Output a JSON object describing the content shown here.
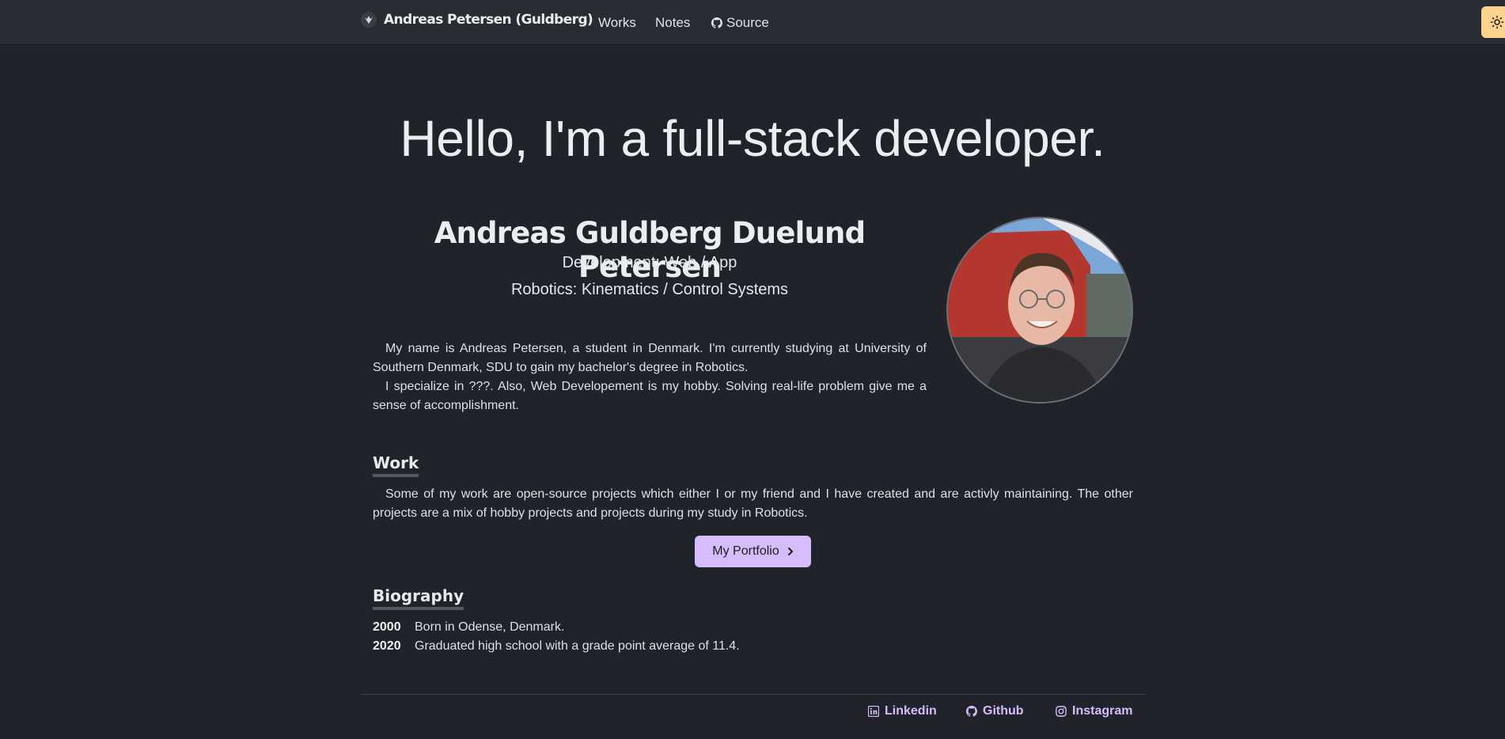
{
  "nav": {
    "brand": "Andreas Petersen (Guldberg)",
    "links": [
      {
        "label": "Works"
      },
      {
        "label": "Notes"
      },
      {
        "label": "Source",
        "icon": "github-icon"
      }
    ],
    "theme_toggle_icon": "sun-icon"
  },
  "hero": {
    "title": "Hello, I'm a full-stack developer."
  },
  "profile": {
    "name": "Andreas Guldberg Duelund Petersen",
    "subtitles": [
      "Development: Web / App",
      "Robotics: Kinematics / Control Systems"
    ]
  },
  "intro": {
    "paragraphs": [
      "My name is Andreas Petersen, a student in Denmark. I'm currently studying at University of Southern Denmark, SDU to gain my bachelor's degree in Robotics.",
      "I specialize in ???. Also, Web Developement is my hobby. Solving real-life problem give me a sense of accomplishment."
    ]
  },
  "work": {
    "heading": "Work",
    "text": "Some of my work are open-source projects which either I or my friend and I have created and are activly maintaining. The other projects are a mix of hobby projects and projects during my study in Robotics.",
    "button_label": "My Portfolio"
  },
  "biography": {
    "heading": "Biography",
    "entries": [
      {
        "year": "2000",
        "text": "Born in Odense, Denmark."
      },
      {
        "year": "2020",
        "text": "Graduated high school with a grade point average of 11.4."
      }
    ]
  },
  "footer": {
    "links": [
      {
        "label": "Linkedin",
        "icon": "linkedin-icon"
      },
      {
        "label": "Github",
        "icon": "github-icon"
      },
      {
        "label": "Instagram",
        "icon": "instagram-icon"
      }
    ]
  },
  "colors": {
    "background": "#202329",
    "navbar": "#292c33",
    "accent": "#d6bcfa",
    "theme_button": "#fbd38d"
  }
}
